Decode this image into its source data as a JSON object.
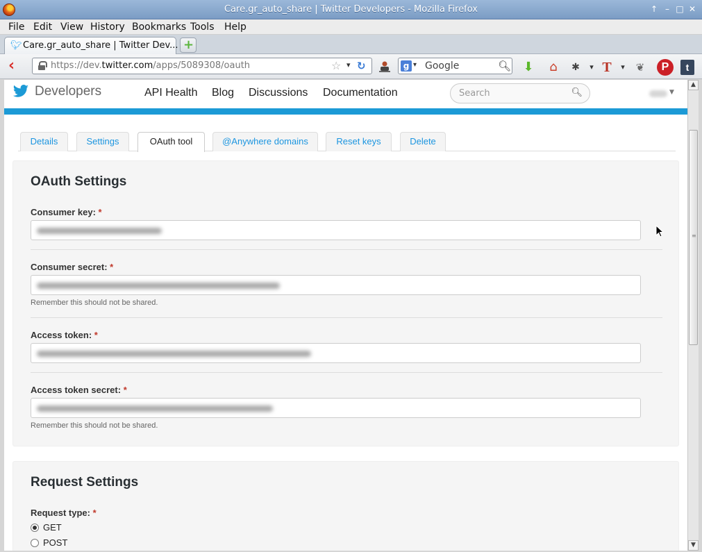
{
  "window": {
    "title": "Care.gr_auto_share | Twitter Developers - Mozilla Firefox"
  },
  "menu": [
    "File",
    "Edit",
    "View",
    "History",
    "Bookmarks",
    "Tools",
    "Help"
  ],
  "tab": {
    "label": "Care.gr_auto_share | Twitter Dev..."
  },
  "urlbar": {
    "prefix": "https://dev.",
    "host": "twitter.com",
    "path": "/apps/5089308/oauth"
  },
  "searchbar": {
    "placeholder": "Google"
  },
  "site": {
    "brand": "Developers",
    "nav": [
      "API Health",
      "Blog",
      "Discussions",
      "Documentation"
    ],
    "search_placeholder": "Search"
  },
  "app_tabs": [
    "Details",
    "Settings",
    "OAuth tool",
    "@Anywhere domains",
    "Reset keys",
    "Delete"
  ],
  "active_app_tab": "OAuth tool",
  "oauth": {
    "title": "OAuth Settings",
    "fields": [
      {
        "label": "Consumer key:",
        "required": "*",
        "hint": ""
      },
      {
        "label": "Consumer secret:",
        "required": "*",
        "hint": "Remember this should not be shared."
      },
      {
        "label": "Access token:",
        "required": "*",
        "hint": ""
      },
      {
        "label": "Access token secret:",
        "required": "*",
        "hint": "Remember this should not be shared."
      }
    ]
  },
  "request": {
    "title": "Request Settings",
    "type_label": "Request type:",
    "required": "*",
    "options": [
      "GET",
      "POST"
    ],
    "selected": "GET"
  },
  "colors": {
    "twitter_blue": "#1c9ad6",
    "link_blue": "#1b95e0",
    "required_red": "#c0392b"
  }
}
